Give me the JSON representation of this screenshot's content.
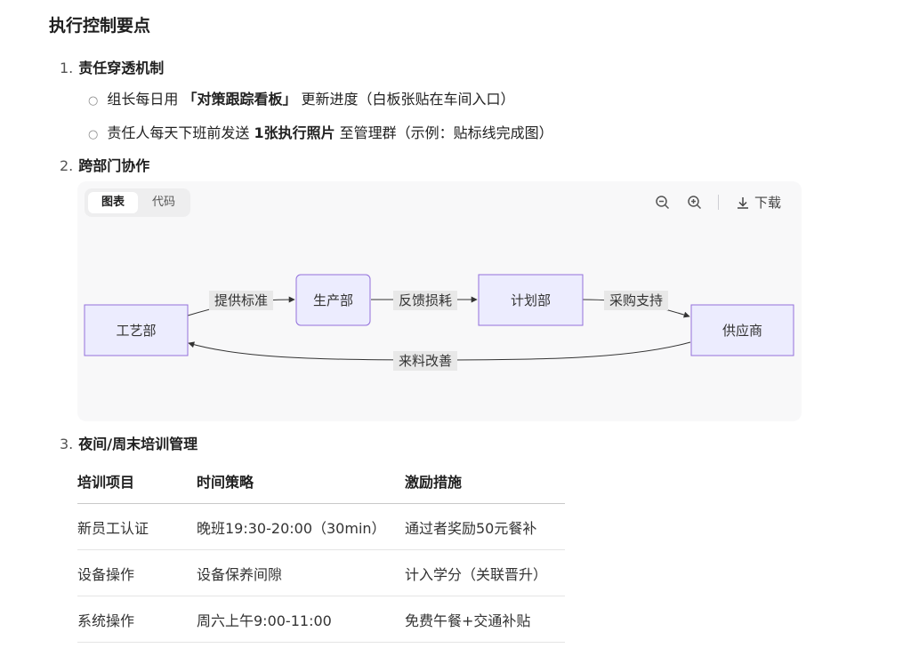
{
  "title": "执行控制要点",
  "items": [
    {
      "num": "1.",
      "title": "责任穿透机制",
      "subs": [
        {
          "pre": "组长每日用 ",
          "bold": "「对策跟踪看板」",
          "post": " 更新进度（白板张贴在车间入口）"
        },
        {
          "pre": "责任人每天下班前发送 ",
          "bold": "1张执行照片",
          "post": " 至管理群（示例：贴标线完成图）"
        }
      ]
    },
    {
      "num": "2.",
      "title": "跨部门协作"
    },
    {
      "num": "3.",
      "title": "夜间/周末培训管理"
    }
  ],
  "diagram": {
    "tabs": {
      "chart": "图表",
      "code": "代码"
    },
    "tools": {
      "zoom_out": "zoom-out-icon",
      "zoom_in": "zoom-in-icon",
      "download_label": "下载"
    },
    "nodes": {
      "craft": "工艺部",
      "production": "生产部",
      "planning": "计划部",
      "supplier": "供应商"
    },
    "edges": {
      "craft_to_production": "提供标准",
      "production_to_planning": "反馈损耗",
      "planning_to_supplier": "采购支持",
      "supplier_to_craft": "来料改善"
    },
    "colors": {
      "node_fill": "#ececfe",
      "node_stroke": "#9370db"
    }
  },
  "table": {
    "headers": [
      "培训项目",
      "时间策略",
      "激励措施"
    ],
    "rows": [
      [
        "新员工认证",
        "晚班19:30-20:00（30min）",
        "通过者奖励50元餐补"
      ],
      [
        "设备操作",
        "设备保养间隙",
        "计入学分（关联晋升）"
      ],
      [
        "系统操作",
        "周六上午9:00-11:00",
        "免费午餐+交通补贴"
      ]
    ]
  }
}
